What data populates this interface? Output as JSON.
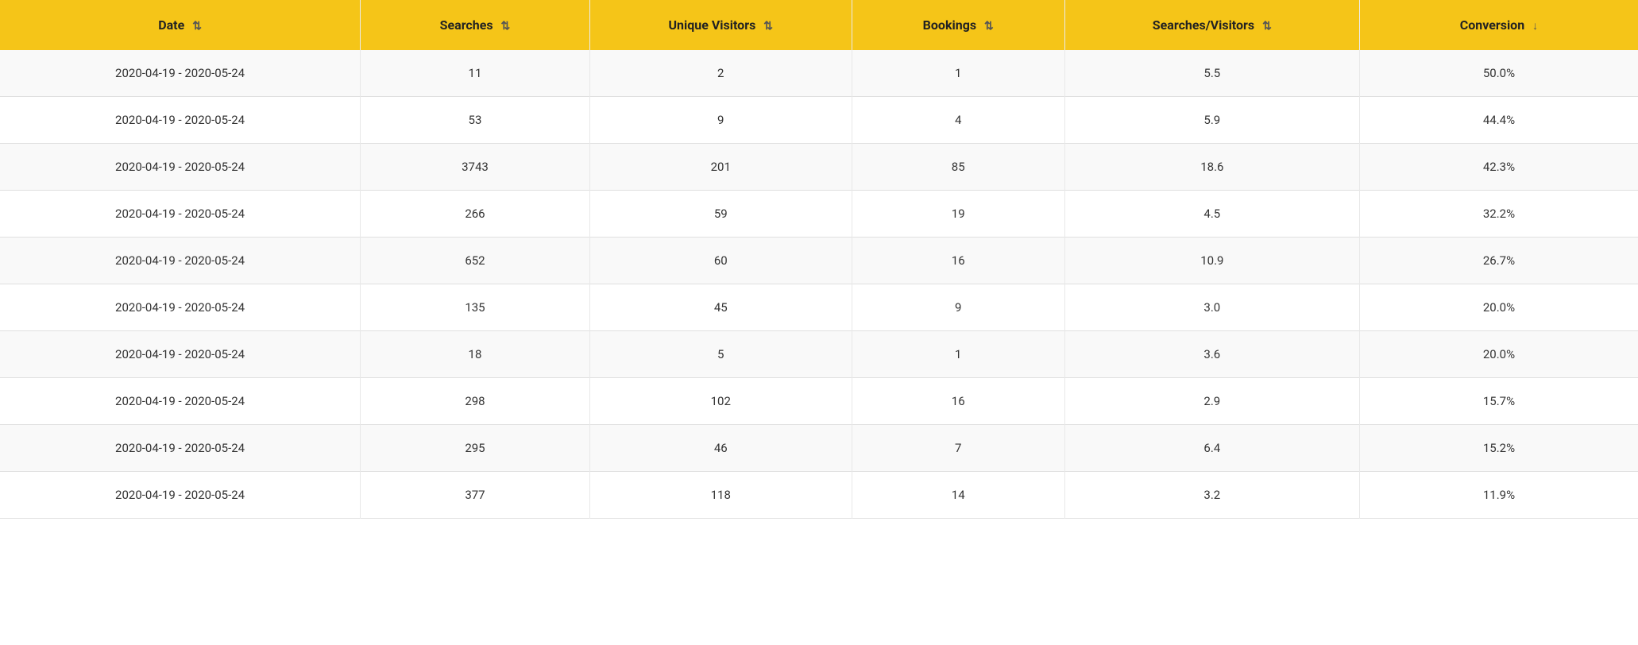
{
  "table": {
    "columns": [
      {
        "id": "date",
        "label": "Date",
        "sort_icon": "⇅",
        "sort_active": false
      },
      {
        "id": "searches",
        "label": "Searches",
        "sort_icon": "⇅",
        "sort_active": false
      },
      {
        "id": "unique_visitors",
        "label": "Unique Visitors",
        "sort_icon": "⇅",
        "sort_active": false
      },
      {
        "id": "bookings",
        "label": "Bookings",
        "sort_icon": "⇅",
        "sort_active": false
      },
      {
        "id": "searches_visitors",
        "label": "Searches/Visitors",
        "sort_icon": "⇅",
        "sort_active": false
      },
      {
        "id": "conversion",
        "label": "Conversion",
        "sort_icon": "↓",
        "sort_active": true
      }
    ],
    "rows": [
      {
        "date": "2020-04-19 - 2020-05-24",
        "searches": "11",
        "unique_visitors": "2",
        "bookings": "1",
        "searches_visitors": "5.5",
        "conversion": "50.0%"
      },
      {
        "date": "2020-04-19 - 2020-05-24",
        "searches": "53",
        "unique_visitors": "9",
        "bookings": "4",
        "searches_visitors": "5.9",
        "conversion": "44.4%"
      },
      {
        "date": "2020-04-19 - 2020-05-24",
        "searches": "3743",
        "unique_visitors": "201",
        "bookings": "85",
        "searches_visitors": "18.6",
        "conversion": "42.3%"
      },
      {
        "date": "2020-04-19 - 2020-05-24",
        "searches": "266",
        "unique_visitors": "59",
        "bookings": "19",
        "searches_visitors": "4.5",
        "conversion": "32.2%"
      },
      {
        "date": "2020-04-19 - 2020-05-24",
        "searches": "652",
        "unique_visitors": "60",
        "bookings": "16",
        "searches_visitors": "10.9",
        "conversion": "26.7%"
      },
      {
        "date": "2020-04-19 - 2020-05-24",
        "searches": "135",
        "unique_visitors": "45",
        "bookings": "9",
        "searches_visitors": "3.0",
        "conversion": "20.0%"
      },
      {
        "date": "2020-04-19 - 2020-05-24",
        "searches": "18",
        "unique_visitors": "5",
        "bookings": "1",
        "searches_visitors": "3.6",
        "conversion": "20.0%"
      },
      {
        "date": "2020-04-19 - 2020-05-24",
        "searches": "298",
        "unique_visitors": "102",
        "bookings": "16",
        "searches_visitors": "2.9",
        "conversion": "15.7%"
      },
      {
        "date": "2020-04-19 - 2020-05-24",
        "searches": "295",
        "unique_visitors": "46",
        "bookings": "7",
        "searches_visitors": "6.4",
        "conversion": "15.2%"
      },
      {
        "date": "2020-04-19 - 2020-05-24",
        "searches": "377",
        "unique_visitors": "118",
        "bookings": "14",
        "searches_visitors": "3.2",
        "conversion": "11.9%"
      }
    ],
    "accent_color": "#F5C518"
  }
}
